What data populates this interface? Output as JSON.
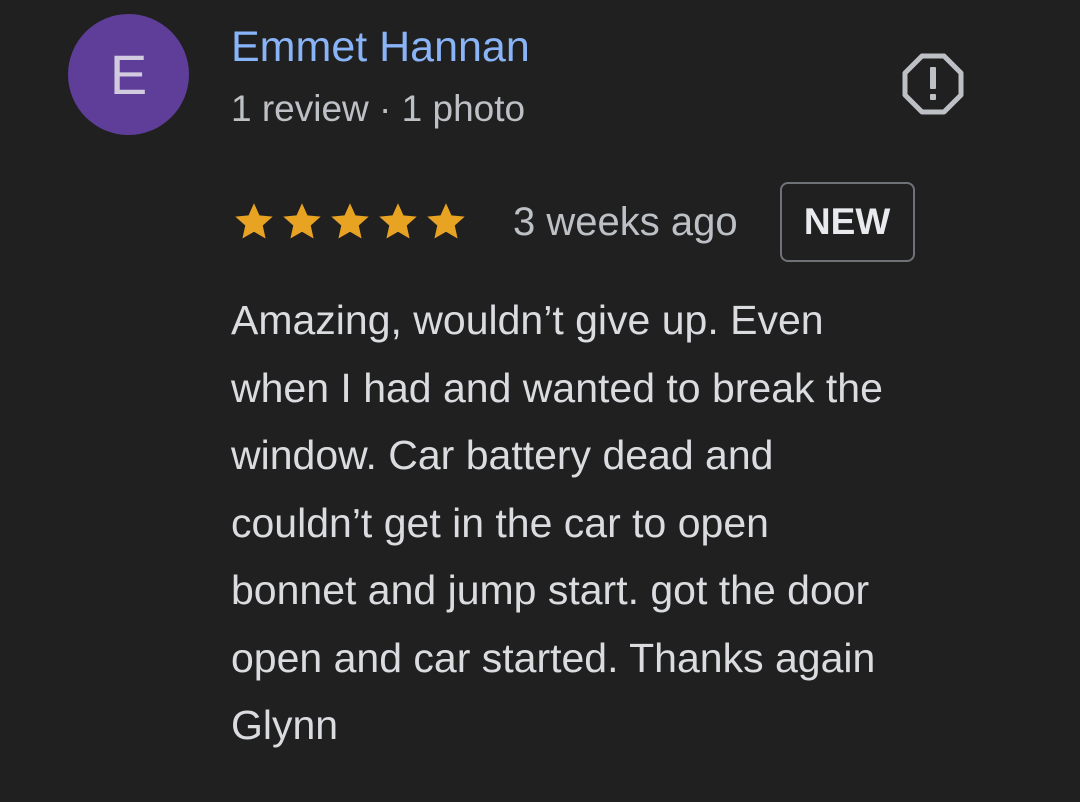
{
  "reviewer": {
    "initial": "E",
    "name": "Emmet Hannan",
    "meta": "1 review · 1 photo",
    "avatar_color": "#5e3e98"
  },
  "actions": {
    "report_icon": "report-flag-octagon-icon"
  },
  "review": {
    "rating": 5,
    "max_rating": 5,
    "star_color": "#e8a323",
    "time_ago": "3 weeks ago",
    "badge": "NEW",
    "text_lines": [
      "Amazing, wouldn’t give up. Even",
      "when I had and wanted to break the",
      "window. Car battery dead and",
      "couldn’t get in the car to open",
      "bonnet and jump start. got the door",
      "open and car started. Thanks again",
      "Glynn"
    ]
  },
  "colors": {
    "background": "#202020",
    "name_link": "#8ab4f8",
    "secondary_text": "#bdc1c6",
    "body_text": "#dadce0"
  }
}
